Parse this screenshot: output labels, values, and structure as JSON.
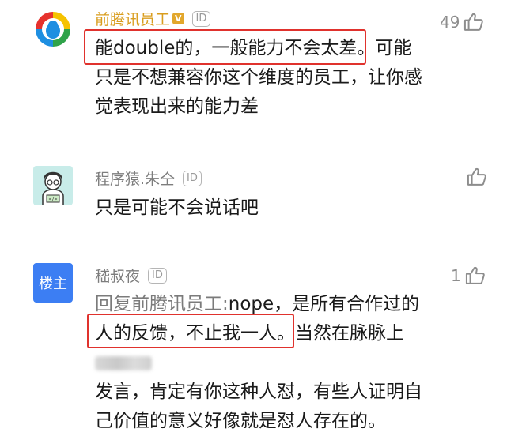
{
  "comments": [
    {
      "author": "前腾讯员工",
      "verified_badge": "V",
      "id_badge": "ID",
      "text_highlighted": "能double的，一般能力不会太差",
      "text_rest": "。可能只是不想兼容你这个维度的员工，让你感觉表现出来的能力差",
      "likes": "49"
    },
    {
      "author": "程序猿.朱仝",
      "id_badge": "ID",
      "text": "只是可能不会说话吧",
      "likes": ""
    },
    {
      "author": "嵇叔夜",
      "id_badge": "ID",
      "avatar_label": "楼主",
      "reply_prefix": "回复前腾讯员工:",
      "text_before": "nope，是所有合作过的",
      "text_highlighted": "人的反馈，不止我一人",
      "text_after_1": "。当然在脉脉上",
      "text_after_2": "发言，肯定有你这种人怼，有些人证明自己价值的意义好像就是怼人存在的。",
      "likes": "1"
    }
  ],
  "icons": {
    "like": "thumbs-up-icon",
    "avatar1": "penguin-icon",
    "avatar2": "programmer-icon"
  },
  "colors": {
    "author_vip": "#d99d1e",
    "highlight_box": "#e0322d",
    "louzhu_bg": "#3c7ef3"
  }
}
